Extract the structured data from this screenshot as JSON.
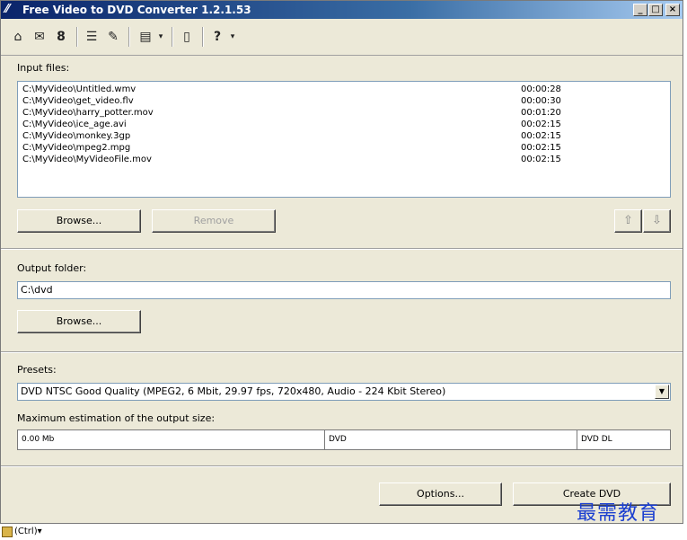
{
  "window": {
    "title": "Free Video to DVD Converter 1.2.1.53"
  },
  "toolbar": {
    "icons": [
      "home-icon",
      "mail-icon",
      "user-icon",
      "list-icon",
      "brush-icon",
      "window-icon",
      "dropdown-icon",
      "fullscreen-icon",
      "help-icon",
      "dropdown-icon"
    ]
  },
  "input": {
    "label": "Input files:",
    "files": [
      {
        "name": "C:\\MyVideo\\Untitled.wmv",
        "duration": "00:00:28"
      },
      {
        "name": "C:\\MyVideo\\get_video.flv",
        "duration": "00:00:30"
      },
      {
        "name": "C:\\MyVideo\\harry_potter.mov",
        "duration": "00:01:20"
      },
      {
        "name": "C:\\MyVideo\\ice_age.avi",
        "duration": "00:02:15"
      },
      {
        "name": "C:\\MyVideo\\monkey.3gp",
        "duration": "00:02:15"
      },
      {
        "name": "C:\\MyVideo\\mpeg2.mpg",
        "duration": "00:02:15"
      },
      {
        "name": "C:\\MyVideo\\MyVideoFile.mov",
        "duration": "00:02:15"
      }
    ],
    "browse_label": "Browse...",
    "remove_label": "Remove"
  },
  "output": {
    "label": "Output folder:",
    "value": "C:\\dvd",
    "browse_label": "Browse..."
  },
  "presets": {
    "label": "Presets:",
    "selected": "DVD NTSC Good Quality (MPEG2, 6 Mbit, 29.97 fps, 720x480, Audio - 224 Kbit Stereo)"
  },
  "estimation": {
    "label": "Maximum estimation of the output size:",
    "current": "0.00 Mb",
    "dvd": "DVD",
    "dvd_dl": "DVD DL"
  },
  "footer": {
    "options_label": "Options...",
    "create_label": "Create DVD"
  },
  "watermark": "最需教育",
  "taskbar": {
    "text": "(Ctrl)▾"
  },
  "colors": {
    "title_start": "#0a246a",
    "title_end": "#a6caf0",
    "face": "#ece9d8",
    "watermark": "#1b3fd0"
  }
}
